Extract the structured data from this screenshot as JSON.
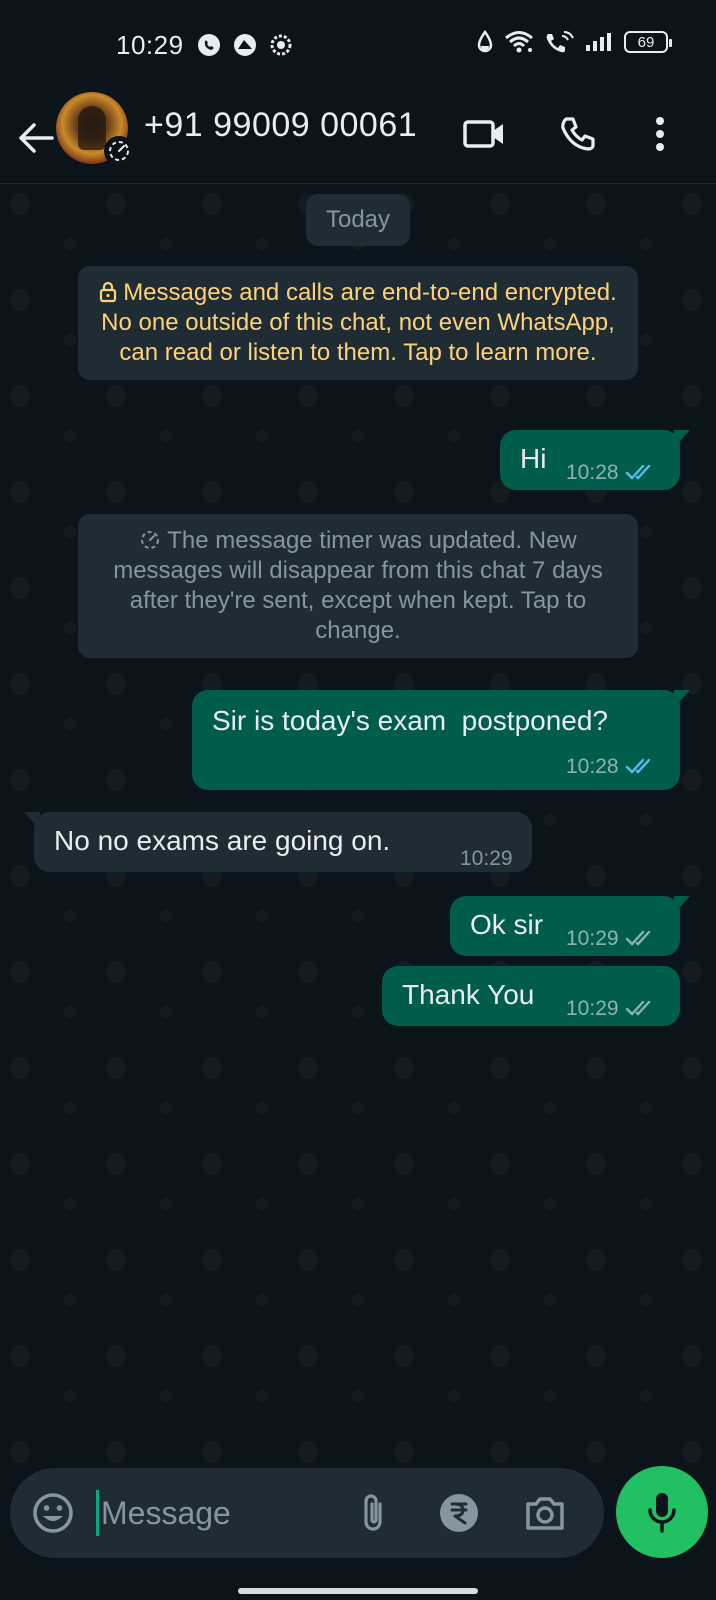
{
  "status_bar": {
    "time": "10:29",
    "battery": "69",
    "icons": [
      "whatsapp-icon",
      "drive-icon",
      "settings-app-icon",
      "data-saver-icon",
      "wifi-icon",
      "wifi-calling-icon",
      "signal-icon",
      "battery-icon"
    ]
  },
  "header": {
    "contact_name": "+91 99009 00061",
    "icons": [
      "back-arrow-icon",
      "disappearing-timer-icon",
      "video-call-icon",
      "voice-call-icon",
      "more-options-icon"
    ]
  },
  "chat": {
    "date_chip": "Today",
    "encryption_notice": "Messages and calls are end-to-end encrypted. No one outside of this chat, not even WhatsApp, can read or listen to them. Tap to learn more.",
    "timer_notice": "The message timer was updated. New messages will disappear from this chat 7 days after they're sent, except when kept. Tap to change.",
    "messages": [
      {
        "direction": "out",
        "text": "Hi",
        "time": "10:28",
        "status": "read"
      },
      {
        "direction": "out",
        "text": "Sir is today's exam  postponed?",
        "time": "10:28",
        "status": "read"
      },
      {
        "direction": "in",
        "text": "No no exams are going on.",
        "time": "10:29"
      },
      {
        "direction": "out",
        "text": "Ok sir",
        "time": "10:29",
        "status": "delivered"
      },
      {
        "direction": "out",
        "text": "Thank You",
        "time": "10:29",
        "status": "delivered"
      }
    ]
  },
  "composer": {
    "placeholder": "Message",
    "icons": [
      "emoji-icon",
      "attach-icon",
      "payment-rupee-icon",
      "camera-icon",
      "mic-icon"
    ]
  },
  "colors": {
    "background": "#0b141a",
    "outgoing_bubble": "#005c4b",
    "incoming_bubble": "#1f2c33",
    "read_ticks": "#53bdeb",
    "encryption_text": "#ffd279",
    "accent": "#21c063"
  }
}
